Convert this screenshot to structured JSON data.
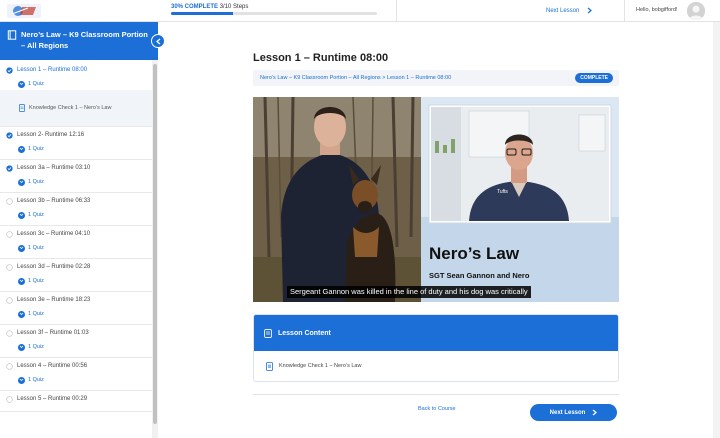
{
  "topbar": {
    "progress_percent_label": "30% COMPLETE",
    "progress_steps": "3/10 Steps",
    "progress_fraction": 0.3,
    "next_lesson": "Next Lesson",
    "greeting": "Hello, bobgifford!"
  },
  "sidebar": {
    "course_title": "Nero’s Law – K9 Classroom Portion – All Regions",
    "lessons": [
      {
        "label": "Lesson 1 – Runtime 08:00",
        "quiz": "1 Quiz",
        "status": "complete",
        "active": true,
        "sub_item": "Knowledge Check 1 – Nero’s Law"
      },
      {
        "label": "Lesson 2- Runtime 12:16",
        "quiz": "1 Quiz",
        "status": "complete"
      },
      {
        "label": "Lesson 3a – Runtime 03:10",
        "quiz": "1 Quiz",
        "status": "complete"
      },
      {
        "label": "Lesson 3b – Runtime 06:33",
        "quiz": "1 Quiz",
        "status": "incomplete"
      },
      {
        "label": "Lesson 3c – Runtime 04:10",
        "quiz": "1 Quiz",
        "status": "incomplete"
      },
      {
        "label": "Lesson 3d – Runtime 02:28",
        "quiz": "1 Quiz",
        "status": "incomplete"
      },
      {
        "label": "Lesson 3e – Runtime 18:23",
        "quiz": "1 Quiz",
        "status": "incomplete"
      },
      {
        "label": "Lesson 3f – Runtime 01:03",
        "quiz": "1 Quiz",
        "status": "incomplete"
      },
      {
        "label": "Lesson 4 – Runtime 00:56",
        "quiz": "1 Quiz",
        "status": "incomplete"
      },
      {
        "label": "Lesson 5 – Runtime 00:29",
        "quiz": "",
        "status": "incomplete"
      }
    ]
  },
  "main": {
    "lesson_title": "Lesson 1 – Runtime 08:00",
    "breadcrumb": "Nero’s Law – K9 Classroom Portion – All Regions > Lesson 1 – Runtime 08:00",
    "status_badge": "COMPLETE",
    "video": {
      "title_text": "Nero’s Law",
      "subtitle_text": "SGT Sean Gannon and Nero",
      "caption": "Sergeant Gannon was killed in the line of duty and his dog was critically",
      "jersey_text": "Tufts"
    },
    "lesson_content_header": "Lesson Content",
    "content_items": [
      "Knowledge Check 1 – Nero’s Law"
    ],
    "back_link": "Back to Course",
    "next_button": "Next Lesson"
  },
  "colors": {
    "accent": "#1b6fd6"
  }
}
